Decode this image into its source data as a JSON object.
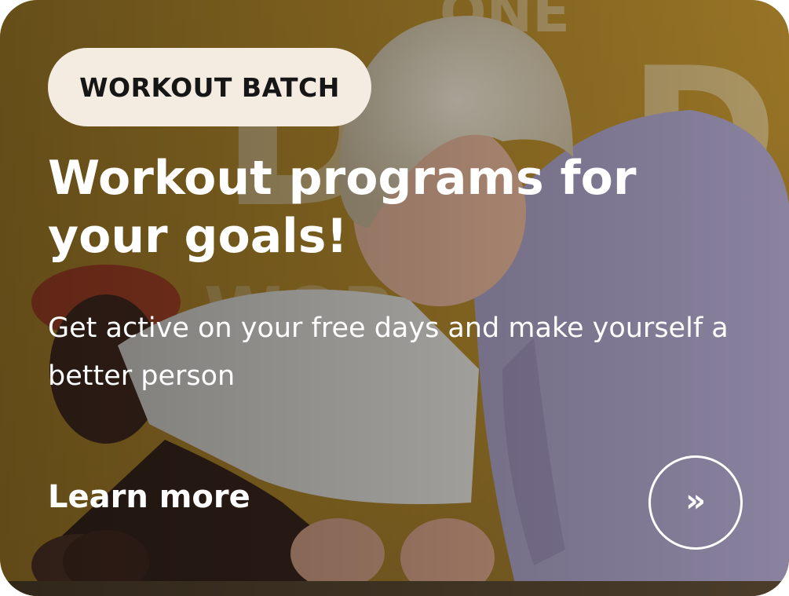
{
  "card": {
    "badge_label": "WORKOUT BATCH",
    "title": "Workout programs for your goals!",
    "subtitle": "Get active on your free days and make yourself a better person",
    "learn_more_label": "Learn more",
    "arrow_glyph": "»"
  },
  "colors": {
    "badge_bg": "#f4ebe1",
    "badge_text": "#161616",
    "text": "#ffffff",
    "background_yellow": "#c79a33"
  },
  "icons": {
    "arrow": "double-chevron-right-icon"
  }
}
